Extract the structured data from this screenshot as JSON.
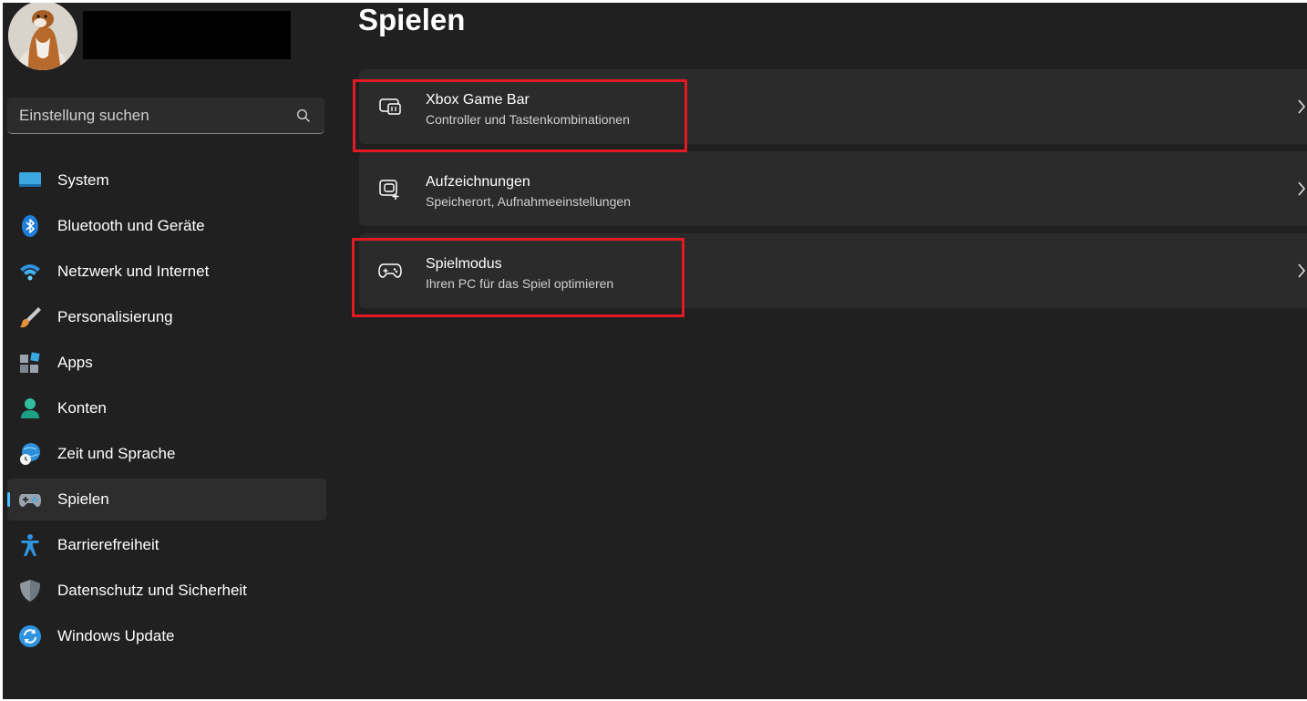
{
  "sidebar": {
    "search": {
      "placeholder": "Einstellung suchen",
      "icon": "search-icon"
    },
    "items": [
      {
        "label": "System",
        "icon": "monitor-icon",
        "active": false
      },
      {
        "label": "Bluetooth und Geräte",
        "icon": "bluetooth-icon",
        "active": false
      },
      {
        "label": "Netzwerk und Internet",
        "icon": "wifi-icon",
        "active": false
      },
      {
        "label": "Personalisierung",
        "icon": "brush-icon",
        "active": false
      },
      {
        "label": "Apps",
        "icon": "apps-icon",
        "active": false
      },
      {
        "label": "Konten",
        "icon": "person-icon",
        "active": false
      },
      {
        "label": "Zeit und Sprache",
        "icon": "globe-clock-icon",
        "active": false
      },
      {
        "label": "Spielen",
        "icon": "gamepad-icon",
        "active": true
      },
      {
        "label": "Barrierefreiheit",
        "icon": "accessibility-icon",
        "active": false
      },
      {
        "label": "Datenschutz und Sicherheit",
        "icon": "shield-icon",
        "active": false
      },
      {
        "label": "Windows Update",
        "icon": "update-icon",
        "active": false
      }
    ]
  },
  "main": {
    "title": "Spielen",
    "cards": [
      {
        "title": "Xbox Game Bar",
        "subtitle": "Controller und Tastenkombinationen",
        "icon": "game-bar-icon",
        "highlighted": true
      },
      {
        "title": "Aufzeichnungen",
        "subtitle": "Speicherort, Aufnahmeeinstellungen",
        "icon": "capture-icon",
        "highlighted": false
      },
      {
        "title": "Spielmodus",
        "subtitle": "Ihren PC für das Spiel optimieren",
        "icon": "gamepad-outline-icon",
        "highlighted": true
      }
    ]
  },
  "colors": {
    "background": "#202020",
    "card": "#2b2b2b",
    "accent": "#4cc2ff",
    "highlight_box": "#e21b23"
  }
}
